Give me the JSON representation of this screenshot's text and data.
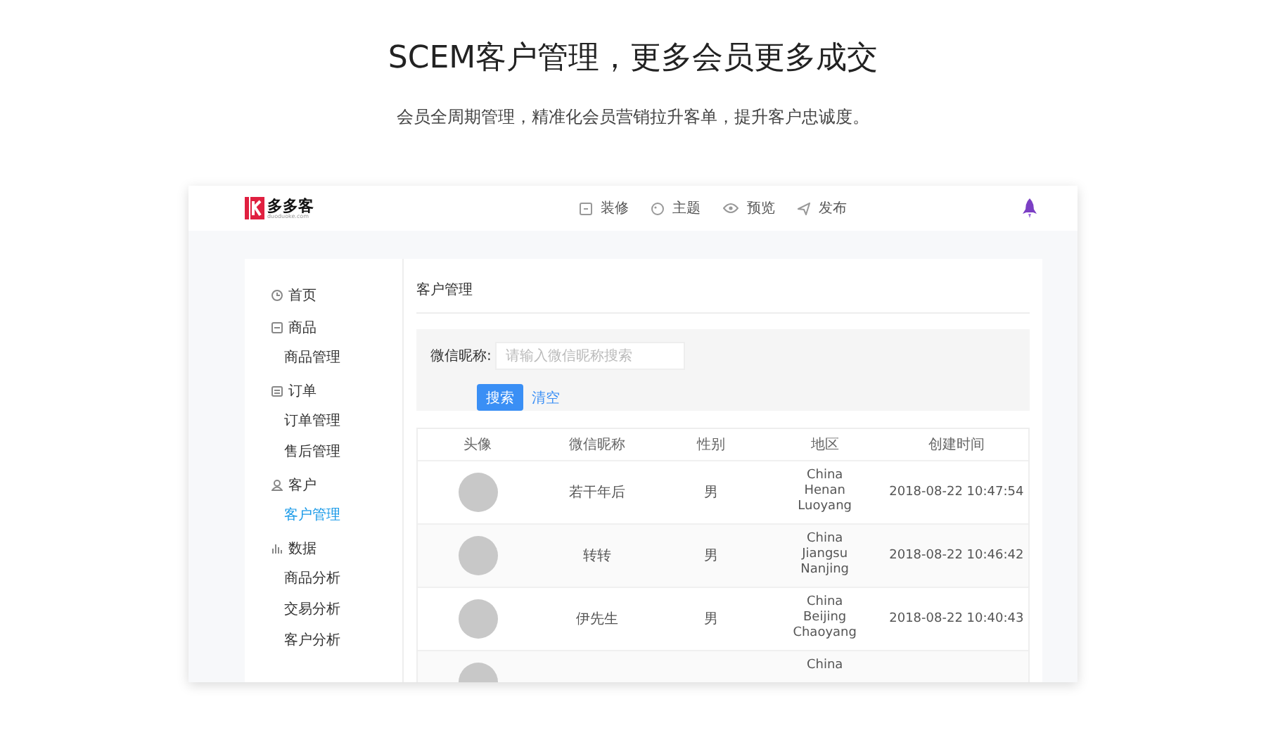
{
  "headline": "SCEM客户管理，更多会员更多成交",
  "subheadline": "会员全周期管理，精准化会员营销拉升客单，提升客户忠诚度。",
  "app": {
    "logo": "多多客",
    "logo_sub": "duoduoke.com",
    "nav": [
      {
        "label": "装修"
      },
      {
        "label": "主题"
      },
      {
        "label": "预览"
      },
      {
        "label": "发布"
      }
    ],
    "sidebar": {
      "items": [
        {
          "label": "首页"
        },
        {
          "label": "商品",
          "children": [
            {
              "label": "商品管理",
              "selected": false
            }
          ]
        },
        {
          "label": "订单",
          "children": [
            {
              "label": "订单管理",
              "selected": false
            },
            {
              "label": "售后管理",
              "selected": false
            }
          ]
        },
        {
          "label": "客户",
          "children": [
            {
              "label": "客户管理",
              "selected": true
            }
          ]
        },
        {
          "label": "数据",
          "children": [
            {
              "label": "商品分析",
              "selected": false
            },
            {
              "label": "交易分析",
              "selected": false
            },
            {
              "label": "客户分析",
              "selected": false
            }
          ]
        }
      ]
    },
    "page_title": "客户管理",
    "search": {
      "label": "微信昵称:",
      "placeholder": "请输入微信昵称搜索",
      "search_button": "搜索",
      "clear_link": "清空"
    },
    "table": {
      "columns": [
        "头像",
        "微信昵称",
        "性别",
        "地区",
        "创建时间"
      ],
      "rows": [
        {
          "nickname": "若干年后",
          "gender": "男",
          "region": [
            "China",
            "Henan",
            "Luoyang"
          ],
          "created": "2018-08-22 10:47:54"
        },
        {
          "nickname": "转转",
          "gender": "男",
          "region": [
            "China",
            "Jiangsu",
            "Nanjing"
          ],
          "created": "2018-08-22 10:46:42"
        },
        {
          "nickname": "伊先生",
          "gender": "男",
          "region": [
            "China",
            "Beijing",
            "Chaoyang"
          ],
          "created": "2018-08-22 10:40:43"
        },
        {
          "region": [
            "China"
          ]
        }
      ]
    }
  }
}
